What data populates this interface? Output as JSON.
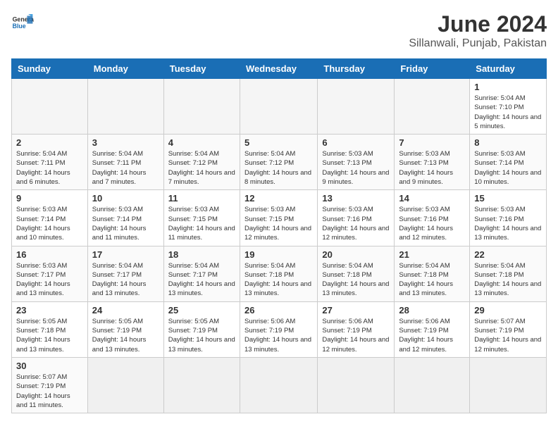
{
  "header": {
    "logo_general": "General",
    "logo_blue": "Blue",
    "month_title": "June 2024",
    "subtitle": "Sillanwali, Punjab, Pakistan"
  },
  "weekdays": [
    "Sunday",
    "Monday",
    "Tuesday",
    "Wednesday",
    "Thursday",
    "Friday",
    "Saturday"
  ],
  "weeks": [
    [
      {
        "day": "",
        "empty": true
      },
      {
        "day": "",
        "empty": true
      },
      {
        "day": "",
        "empty": true
      },
      {
        "day": "",
        "empty": true
      },
      {
        "day": "",
        "empty": true
      },
      {
        "day": "",
        "empty": true
      },
      {
        "day": "1",
        "sunrise": "5:04 AM",
        "sunset": "7:10 PM",
        "daylight": "14 hours and 5 minutes."
      }
    ],
    [
      {
        "day": "2",
        "sunrise": "5:04 AM",
        "sunset": "7:11 PM",
        "daylight": "14 hours and 6 minutes."
      },
      {
        "day": "3",
        "sunrise": "5:04 AM",
        "sunset": "7:11 PM",
        "daylight": "14 hours and 7 minutes."
      },
      {
        "day": "4",
        "sunrise": "5:04 AM",
        "sunset": "7:12 PM",
        "daylight": "14 hours and 7 minutes."
      },
      {
        "day": "5",
        "sunrise": "5:04 AM",
        "sunset": "7:12 PM",
        "daylight": "14 hours and 8 minutes."
      },
      {
        "day": "6",
        "sunrise": "5:03 AM",
        "sunset": "7:13 PM",
        "daylight": "14 hours and 9 minutes."
      },
      {
        "day": "7",
        "sunrise": "5:03 AM",
        "sunset": "7:13 PM",
        "daylight": "14 hours and 9 minutes."
      },
      {
        "day": "8",
        "sunrise": "5:03 AM",
        "sunset": "7:14 PM",
        "daylight": "14 hours and 10 minutes."
      }
    ],
    [
      {
        "day": "9",
        "sunrise": "5:03 AM",
        "sunset": "7:14 PM",
        "daylight": "14 hours and 10 minutes."
      },
      {
        "day": "10",
        "sunrise": "5:03 AM",
        "sunset": "7:14 PM",
        "daylight": "14 hours and 11 minutes."
      },
      {
        "day": "11",
        "sunrise": "5:03 AM",
        "sunset": "7:15 PM",
        "daylight": "14 hours and 11 minutes."
      },
      {
        "day": "12",
        "sunrise": "5:03 AM",
        "sunset": "7:15 PM",
        "daylight": "14 hours and 12 minutes."
      },
      {
        "day": "13",
        "sunrise": "5:03 AM",
        "sunset": "7:16 PM",
        "daylight": "14 hours and 12 minutes."
      },
      {
        "day": "14",
        "sunrise": "5:03 AM",
        "sunset": "7:16 PM",
        "daylight": "14 hours and 12 minutes."
      },
      {
        "day": "15",
        "sunrise": "5:03 AM",
        "sunset": "7:16 PM",
        "daylight": "14 hours and 13 minutes."
      }
    ],
    [
      {
        "day": "16",
        "sunrise": "5:03 AM",
        "sunset": "7:17 PM",
        "daylight": "14 hours and 13 minutes."
      },
      {
        "day": "17",
        "sunrise": "5:04 AM",
        "sunset": "7:17 PM",
        "daylight": "14 hours and 13 minutes."
      },
      {
        "day": "18",
        "sunrise": "5:04 AM",
        "sunset": "7:17 PM",
        "daylight": "14 hours and 13 minutes."
      },
      {
        "day": "19",
        "sunrise": "5:04 AM",
        "sunset": "7:18 PM",
        "daylight": "14 hours and 13 minutes."
      },
      {
        "day": "20",
        "sunrise": "5:04 AM",
        "sunset": "7:18 PM",
        "daylight": "14 hours and 13 minutes."
      },
      {
        "day": "21",
        "sunrise": "5:04 AM",
        "sunset": "7:18 PM",
        "daylight": "14 hours and 13 minutes."
      },
      {
        "day": "22",
        "sunrise": "5:04 AM",
        "sunset": "7:18 PM",
        "daylight": "14 hours and 13 minutes."
      }
    ],
    [
      {
        "day": "23",
        "sunrise": "5:05 AM",
        "sunset": "7:18 PM",
        "daylight": "14 hours and 13 minutes."
      },
      {
        "day": "24",
        "sunrise": "5:05 AM",
        "sunset": "7:19 PM",
        "daylight": "14 hours and 13 minutes."
      },
      {
        "day": "25",
        "sunrise": "5:05 AM",
        "sunset": "7:19 PM",
        "daylight": "14 hours and 13 minutes."
      },
      {
        "day": "26",
        "sunrise": "5:06 AM",
        "sunset": "7:19 PM",
        "daylight": "14 hours and 13 minutes."
      },
      {
        "day": "27",
        "sunrise": "5:06 AM",
        "sunset": "7:19 PM",
        "daylight": "14 hours and 12 minutes."
      },
      {
        "day": "28",
        "sunrise": "5:06 AM",
        "sunset": "7:19 PM",
        "daylight": "14 hours and 12 minutes."
      },
      {
        "day": "29",
        "sunrise": "5:07 AM",
        "sunset": "7:19 PM",
        "daylight": "14 hours and 12 minutes."
      }
    ],
    [
      {
        "day": "30",
        "sunrise": "5:07 AM",
        "sunset": "7:19 PM",
        "daylight": "14 hours and 11 minutes."
      },
      {
        "day": "",
        "empty": true
      },
      {
        "day": "",
        "empty": true
      },
      {
        "day": "",
        "empty": true
      },
      {
        "day": "",
        "empty": true
      },
      {
        "day": "",
        "empty": true
      },
      {
        "day": "",
        "empty": true
      }
    ]
  ],
  "labels": {
    "sunrise": "Sunrise:",
    "sunset": "Sunset:",
    "daylight": "Daylight:"
  }
}
